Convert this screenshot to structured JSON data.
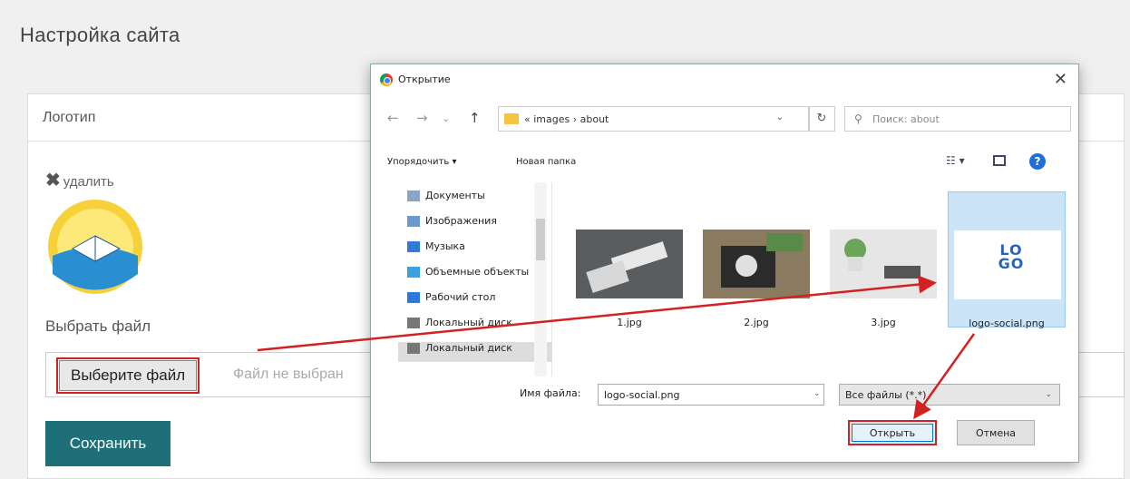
{
  "page": {
    "title": "Настройка сайта"
  },
  "card": {
    "header": "Логотип",
    "delete_label": "удалить",
    "choose_label": "Выбрать файл",
    "file_button": "Выберите файл",
    "file_status": "Файл не выбран",
    "save_button": "Сохранить"
  },
  "dialog": {
    "title": "Открытие",
    "close": "✕",
    "path": "«  images  ›  about",
    "search_placeholder": "Поиск: about",
    "organize": "Упорядочить ▾",
    "new_folder": "Новая папка",
    "sidebar": [
      {
        "label": "Документы",
        "icon": "documents-icon",
        "color": "#8aa3c7"
      },
      {
        "label": "Изображения",
        "icon": "pictures-icon",
        "color": "#6a9ad0"
      },
      {
        "label": "Музыка",
        "icon": "music-icon",
        "color": "#2f7ad8"
      },
      {
        "label": "Объемные объекты",
        "icon": "3d-objects-icon",
        "color": "#3aa0e0"
      },
      {
        "label": "Рабочий стол",
        "icon": "desktop-icon",
        "color": "#2a7ad8"
      },
      {
        "label": "Локальный диск",
        "icon": "drive-icon",
        "color": "#777"
      },
      {
        "label": "Локальный диск",
        "icon": "drive-icon",
        "color": "#777"
      }
    ],
    "files": [
      {
        "name": "1.jpg"
      },
      {
        "name": "2.jpg"
      },
      {
        "name": "3.jpg"
      },
      {
        "name": "logo-social.png",
        "thumb_text": "LO GO"
      }
    ],
    "filename_label": "Имя файла:",
    "filename_value": "logo-social.png",
    "filter": "Все файлы (*.*)",
    "open_button": "Открыть",
    "cancel_button": "Отмена"
  },
  "colors": {
    "accent": "#1e6f78",
    "highlight": "#d32020",
    "selection": "#cce4f7"
  }
}
